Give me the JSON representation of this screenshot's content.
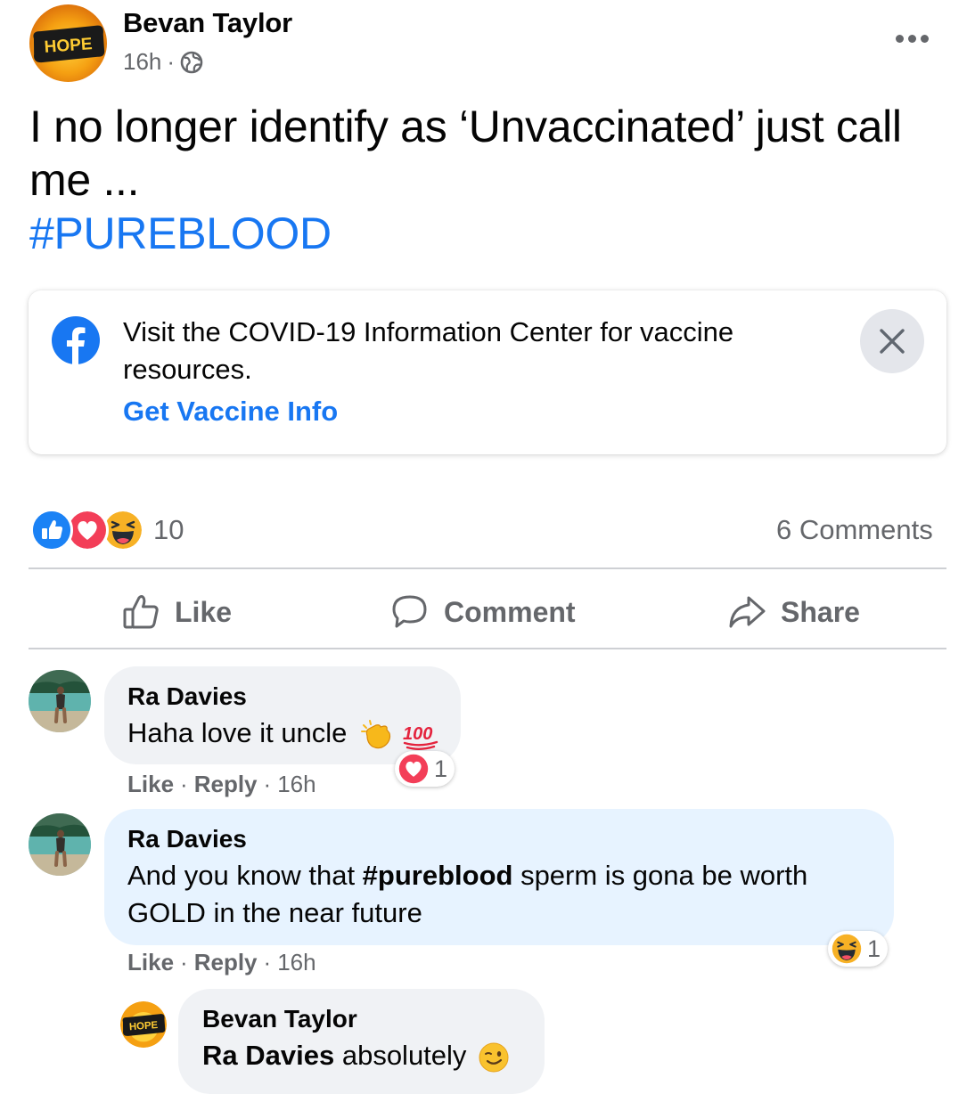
{
  "post": {
    "author": "Bevan Taylor",
    "avatar_text": "HOPE",
    "time": "16h",
    "separator": "·",
    "audience_icon": "globe-icon",
    "more_icon": "more-dots-icon",
    "text": "I no longer identify as ‘Unvaccinated’ just call me ...",
    "hashtag": "#PUREBLOOD"
  },
  "covid_card": {
    "icon": "facebook-logo-icon",
    "text": "Visit the COVID-19 Information Center for vaccine resources.",
    "link": "Get Vaccine Info",
    "close_icon": "close-icon"
  },
  "reactions": {
    "icons": [
      "like-reaction-icon",
      "love-reaction-icon",
      "haha-reaction-icon"
    ],
    "count": "10",
    "comments": "6 Comments"
  },
  "actions": {
    "like": "Like",
    "comment": "Comment",
    "share": "Share"
  },
  "comments": [
    {
      "author": "Ra Davies",
      "text": "Haha love it uncle",
      "emojis": [
        "clapping-hands-emoji",
        "hundred-points-emoji"
      ],
      "like": "Like",
      "reply": "Reply",
      "time": "16h",
      "reaction_count": "1",
      "reaction_icon": "love-reaction-icon"
    },
    {
      "author": "Ra Davies",
      "text_before": "And you know that ",
      "hashtag": "#pureblood",
      "text_after": " sperm is gona be worth GOLD in the near future",
      "like": "Like",
      "reply": "Reply",
      "time": "16h",
      "reaction_count": "1",
      "reaction_icon": "haha-reaction-icon"
    },
    {
      "author": "Bevan Taylor",
      "mention": "Ra Davies",
      "text": " absolutely",
      "emoji": "winking-face-emoji"
    }
  ],
  "colors": {
    "link_blue": "#1877f2",
    "secondary_text": "#65676b",
    "bubble_gray": "#f0f2f5",
    "bubble_highlight": "#e7f3ff"
  }
}
